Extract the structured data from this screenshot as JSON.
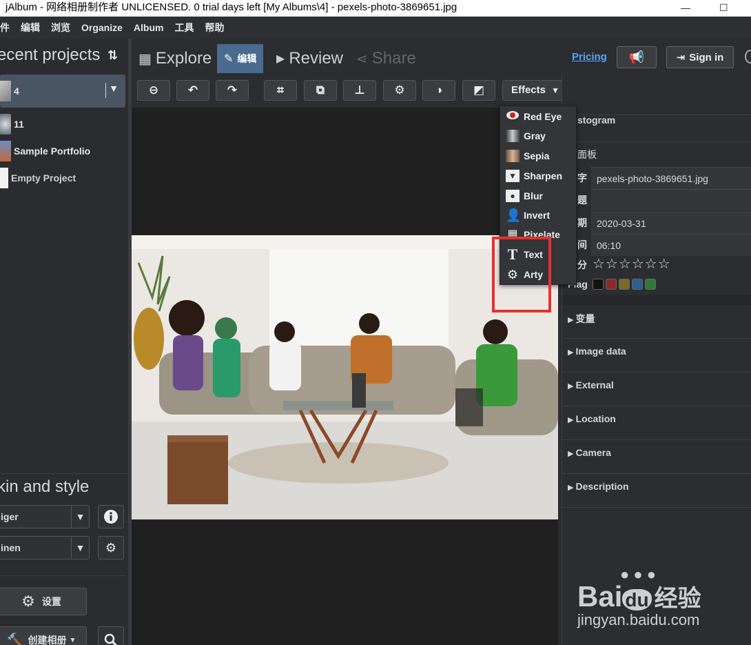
{
  "titlebar": {
    "text": "jAlbum - 网络相册制作者 UNLICENSED. 0 trial days left [My Albums\\4] - pexels-photo-3869651.jpg",
    "min": "—",
    "max": "☐"
  },
  "menubar": [
    "件",
    "编辑",
    "浏览",
    "Organize",
    "Album",
    "工具",
    "帮助"
  ],
  "left": {
    "projects_header": "ecent projects",
    "projects": [
      {
        "name": "4"
      },
      {
        "name": "11"
      },
      {
        "name": "Sample Portfolio"
      },
      {
        "name": "Empty Project"
      }
    ],
    "skin_header": "kin and style",
    "skin_value": "iger",
    "style_value": "inen",
    "settings_label": "设置",
    "create_label": "创建相册"
  },
  "nav": {
    "explore": "Explore",
    "edit": "编辑",
    "review": "Review",
    "share": "Share",
    "pricing": "Pricing",
    "sign_in": "Sign in"
  },
  "toolbar": {
    "effects": "Effects"
  },
  "effects_menu": {
    "items": [
      "Red Eye",
      "Gray",
      "Sepia",
      "Sharpen",
      "Blur",
      "Invert",
      "Pixelate",
      "Text",
      "Arty"
    ]
  },
  "right": {
    "histogram": "Histogram",
    "main_panel": "主面板",
    "fields": [
      {
        "key": "字",
        "value": "pexels-photo-3869651.jpg"
      },
      {
        "key": "题",
        "value": ""
      },
      {
        "key": "期",
        "value": "2020-03-31"
      },
      {
        "key": "间",
        "value": "06:10"
      }
    ],
    "rating_label": "分",
    "rating_stars": 0,
    "rating_max": 6,
    "flag_label": "Flag",
    "flag_colors": [
      "#111111",
      "#8b2a2a",
      "#7a6a2a",
      "#2d5f8f",
      "#2f7a3a"
    ],
    "sections": [
      "变量",
      "Image data",
      "External",
      "Location",
      "Camera",
      "Description"
    ]
  },
  "watermark": {
    "brand_left": "Bai",
    "brand_mid": "du",
    "brand_right": "经验",
    "url": "jingyan.baidu.com"
  }
}
